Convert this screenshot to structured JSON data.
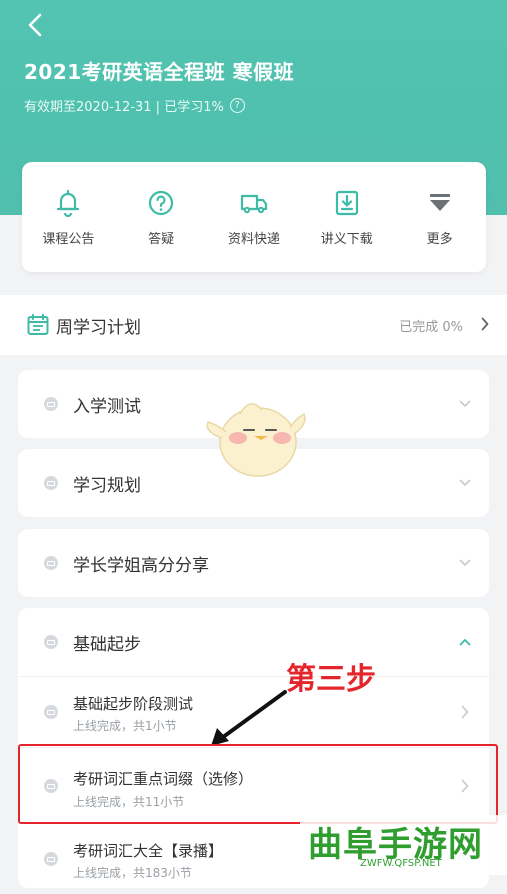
{
  "header": {
    "title": "2021考研英语全程班 寒假班",
    "subtitle": "有效期至2020-12-31 | 已学习1%",
    "help_glyph": "?"
  },
  "tools": [
    {
      "label": "课程公告",
      "icon": "bell-icon"
    },
    {
      "label": "答疑",
      "icon": "question-icon"
    },
    {
      "label": "资料快递",
      "icon": "truck-icon"
    },
    {
      "label": "讲义下载",
      "icon": "download-icon"
    },
    {
      "label": "更多",
      "icon": "more-icon"
    }
  ],
  "plan": {
    "title": "周学习计划",
    "status": "已完成 0%"
  },
  "sections": [
    {
      "title": "入学测试"
    },
    {
      "title": "学习规划"
    },
    {
      "title": "学长学姐高分分享"
    },
    {
      "title": "基础起步"
    }
  ],
  "subitems": [
    {
      "title": "基础起步阶段测试",
      "meta": "上线完成，共1小节"
    },
    {
      "title": "考研词汇重点词缀（选修）",
      "meta": "上线完成，共11小节"
    },
    {
      "title": "考研词汇大全【录播】",
      "meta": "上线完成，共183小节"
    }
  ],
  "annotation": {
    "step_label": "第三步"
  },
  "watermark": {
    "main": "曲阜手游网",
    "sub": "ZWFW.QFSP.NET"
  },
  "colors": {
    "accent": "#4fc0ad",
    "highlight": "#e4262c",
    "watermark": "#2f9e2f"
  }
}
